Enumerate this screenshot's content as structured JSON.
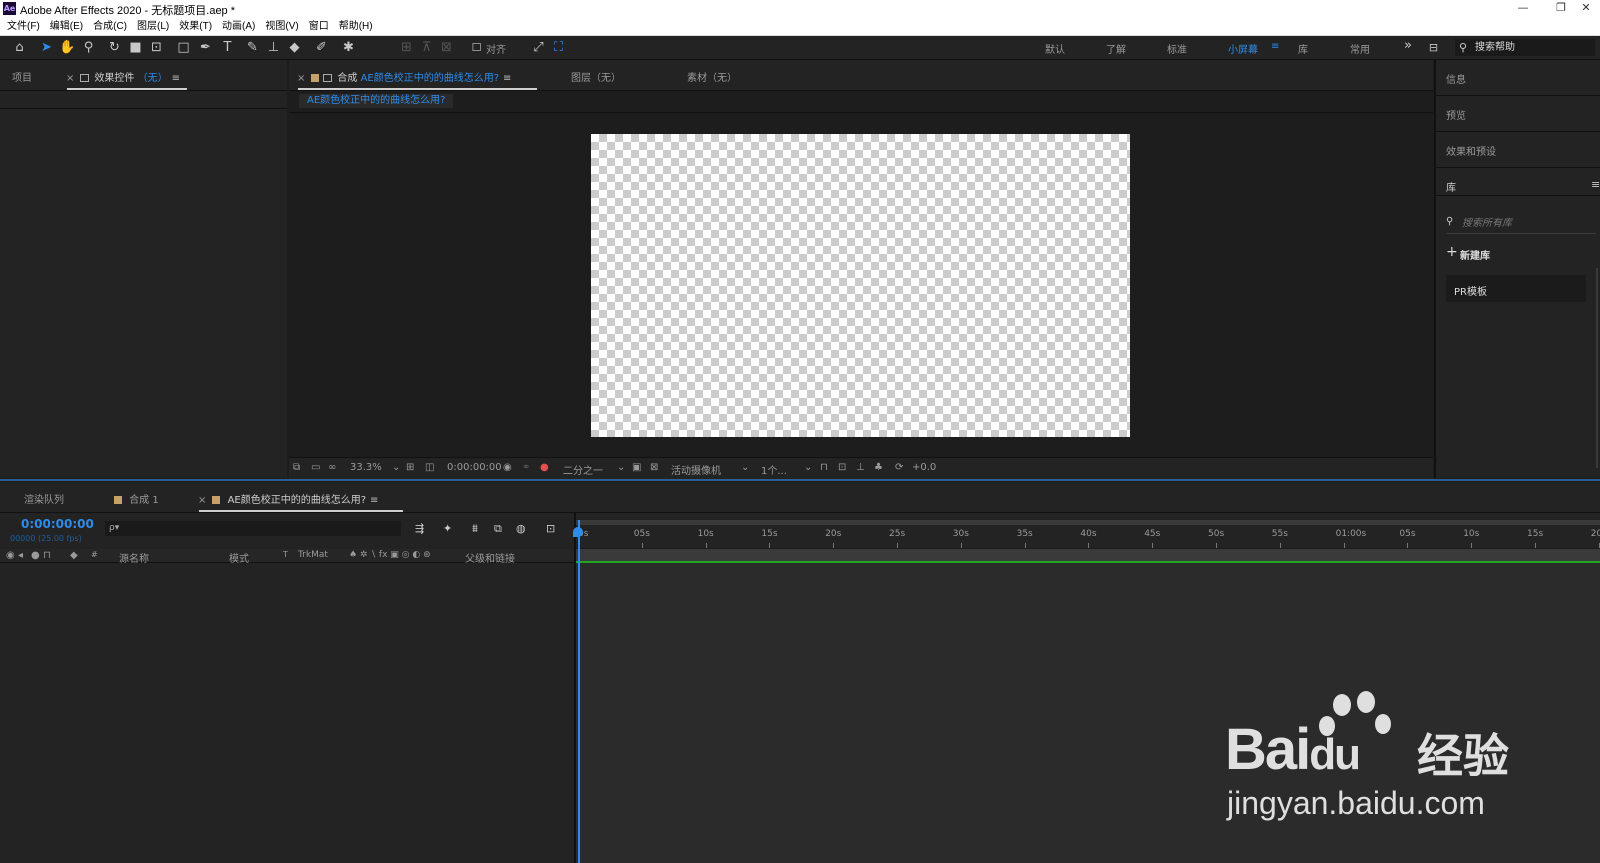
{
  "window": {
    "title": "Adobe After Effects 2020 - 无标题项目.aep *",
    "logo": "Ae",
    "minimize": "—",
    "restore": "❐",
    "close": "✕"
  },
  "menu": {
    "items": [
      "文件(F)",
      "编辑(E)",
      "合成(C)",
      "图层(L)",
      "效果(T)",
      "动画(A)",
      "视图(V)",
      "窗口",
      "帮助(H)"
    ]
  },
  "toolbar": {
    "snap_label": "对齐",
    "workspaces": [
      "默认",
      "了解",
      "标准",
      "小屏幕",
      "库",
      "常用"
    ],
    "active_workspace": "小屏幕",
    "more": "»",
    "help_placeholder": "搜索帮助"
  },
  "project_panel": {
    "tab_project": "项目",
    "tab_effects": "效果控件",
    "tab_effects_suffix": "（无）"
  },
  "composition_panel": {
    "tab_comp_prefix": "合成",
    "tab_comp_name": "AE颜色校正中的的曲线怎么用?",
    "tab_layer": "图层（无）",
    "tab_footage": "素材（无）",
    "breadcrumb": "AE颜色校正中的的曲线怎么用?"
  },
  "viewer_footer": {
    "zoom": "33.3%",
    "timecode": "0:00:00:00",
    "resolution": "二分之一",
    "camera": "活动摄像机",
    "views": "1个...",
    "exposure": "+0.0"
  },
  "right_panel": {
    "info": "信息",
    "preview": "预览",
    "effects_presets": "效果和预设",
    "library": "库",
    "library_search_placeholder": "搜索所有库",
    "new_library": "新建库",
    "library_item": "PR模板"
  },
  "timeline": {
    "tab_render": "渲染队列",
    "tab_comp1": "合成 1",
    "tab_active": "AE颜色校正中的的曲线怎么用?",
    "current_time": "0:00:00:00",
    "frame_info": "00000 (25.00 fps)",
    "search_placeholder": "ρ▾",
    "headers": {
      "source_name": "源名称",
      "mode": "模式",
      "t": "T",
      "trkmat": "TrkMat",
      "parent": "父级和链接",
      "hash": "#"
    },
    "ruler_ticks": [
      "0s",
      "05s",
      "10s",
      "15s",
      "20s",
      "25s",
      "30s",
      "35s",
      "40s",
      "45s",
      "50s",
      "55s",
      "01:00s",
      "05s",
      "10s",
      "15s",
      "20"
    ]
  },
  "watermark": {
    "brand": "Bai",
    "brand2": "du",
    "cn": "经验",
    "url": "jingyan.baidu.com"
  },
  "colors": {
    "accent": "#2d8ceb",
    "panel": "#232323",
    "workarea": "#22a722"
  }
}
